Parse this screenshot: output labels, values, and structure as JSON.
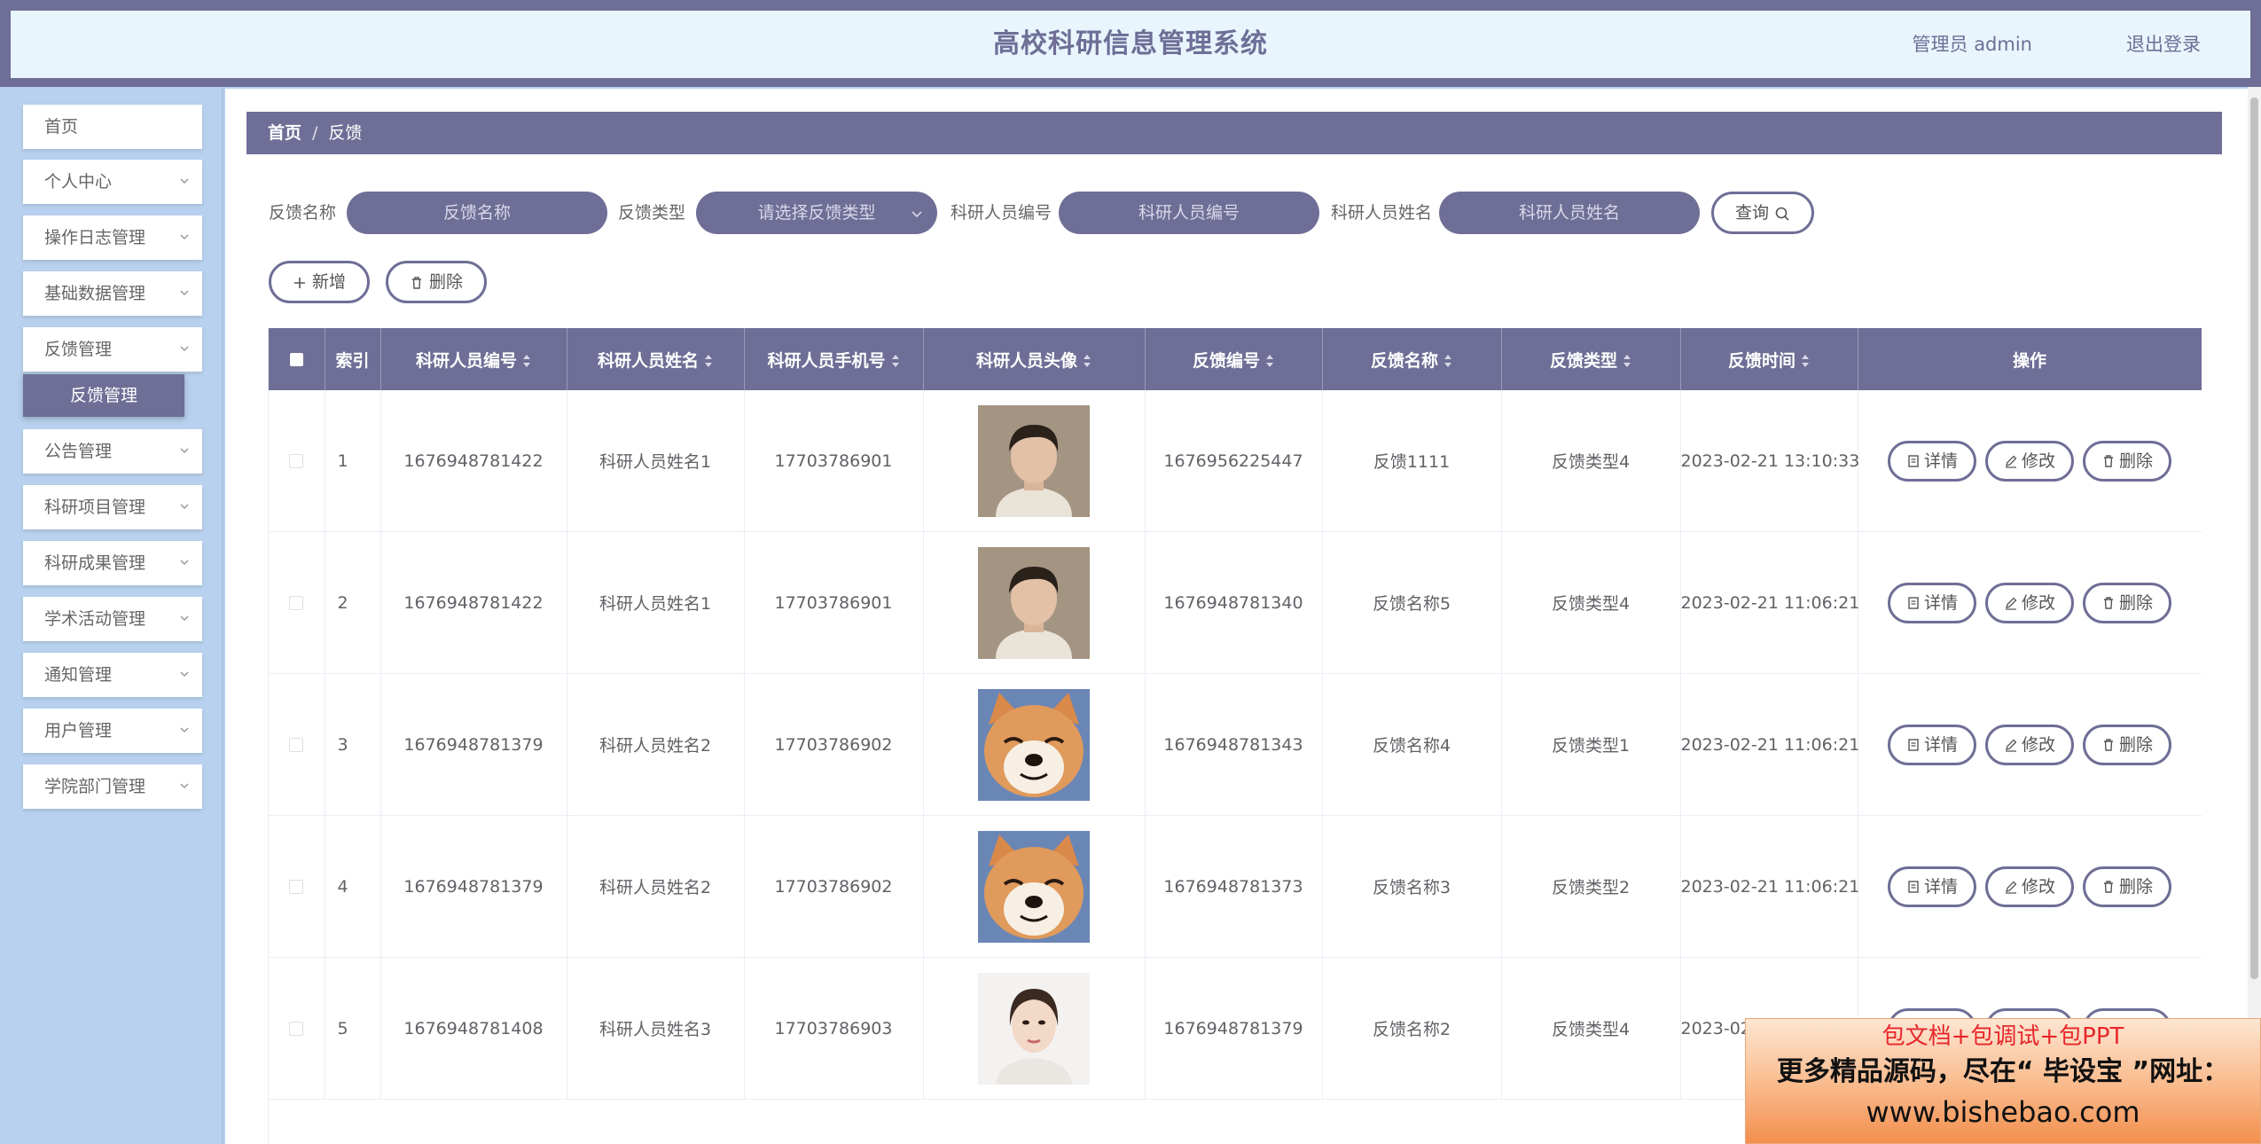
{
  "header": {
    "title": "高校科研信息管理系统",
    "user": "管理员 admin",
    "logout": "退出登录"
  },
  "sidebar": {
    "items": [
      {
        "label": "首页"
      },
      {
        "label": "个人中心"
      },
      {
        "label": "操作日志管理"
      },
      {
        "label": "基础数据管理"
      },
      {
        "label": "反馈管理"
      },
      {
        "label": "公告管理"
      },
      {
        "label": "科研项目管理"
      },
      {
        "label": "科研成果管理"
      },
      {
        "label": "学术活动管理"
      },
      {
        "label": "通知管理"
      },
      {
        "label": "用户管理"
      },
      {
        "label": "学院部门管理"
      }
    ],
    "active_sub": "反馈管理"
  },
  "breadcrumb": {
    "home": "首页",
    "separator": "/",
    "current": "反馈"
  },
  "search": {
    "name_label": "反馈名称",
    "name_placeholder": "反馈名称",
    "type_label": "反馈类型",
    "type_placeholder": "请选择反馈类型",
    "code_label": "科研人员编号",
    "code_placeholder": "科研人员编号",
    "person_label": "科研人员姓名",
    "person_placeholder": "科研人员姓名",
    "query_button": "查询"
  },
  "actions": {
    "add": "新增",
    "delete": "删除"
  },
  "table": {
    "columns": [
      "索引",
      "科研人员编号",
      "科研人员姓名",
      "科研人员手机号",
      "科研人员头像",
      "反馈编号",
      "反馈名称",
      "反馈类型",
      "反馈时间",
      "操作"
    ],
    "row_buttons": {
      "detail": "详情",
      "edit": "修改",
      "delete": "删除"
    },
    "rows": [
      {
        "index": "1",
        "code": "1676948781422",
        "name": "科研人员姓名1",
        "phone": "17703786901",
        "avatar": "man-avatar",
        "fb_code": "1676956225447",
        "fb_name": "反馈1111",
        "fb_type": "反馈类型4",
        "time": "2023-02-21 13:10:33"
      },
      {
        "index": "2",
        "code": "1676948781422",
        "name": "科研人员姓名1",
        "phone": "17703786901",
        "avatar": "man-avatar",
        "fb_code": "1676948781340",
        "fb_name": "反馈名称5",
        "fb_type": "反馈类型4",
        "time": "2023-02-21 11:06:21"
      },
      {
        "index": "3",
        "code": "1676948781379",
        "name": "科研人员姓名2",
        "phone": "17703786902",
        "avatar": "dog-avatar",
        "fb_code": "1676948781343",
        "fb_name": "反馈名称4",
        "fb_type": "反馈类型1",
        "time": "2023-02-21 11:06:21"
      },
      {
        "index": "4",
        "code": "1676948781379",
        "name": "科研人员姓名2",
        "phone": "17703786902",
        "avatar": "dog-avatar",
        "fb_code": "1676948781373",
        "fb_name": "反馈名称3",
        "fb_type": "反馈类型2",
        "time": "2023-02-21 11:06:21"
      },
      {
        "index": "5",
        "code": "1676948781408",
        "name": "科研人员姓名3",
        "phone": "17703786903",
        "avatar": "woman-avatar",
        "fb_code": "1676948781379",
        "fb_name": "反馈名称2",
        "fb_type": "反馈类型4",
        "time": "2023-02-21 11:06:21"
      }
    ]
  },
  "ad": {
    "line1": "包文档+包调试+包PPT",
    "line2": "更多精品源码，尽在“ 毕设宝 ”网址：",
    "line3": "www.bishebao.com"
  },
  "colors": {
    "primary": "#6e6e96",
    "sidebar_bg": "#b8d1ee",
    "header_bg": "#e8f5fd"
  }
}
